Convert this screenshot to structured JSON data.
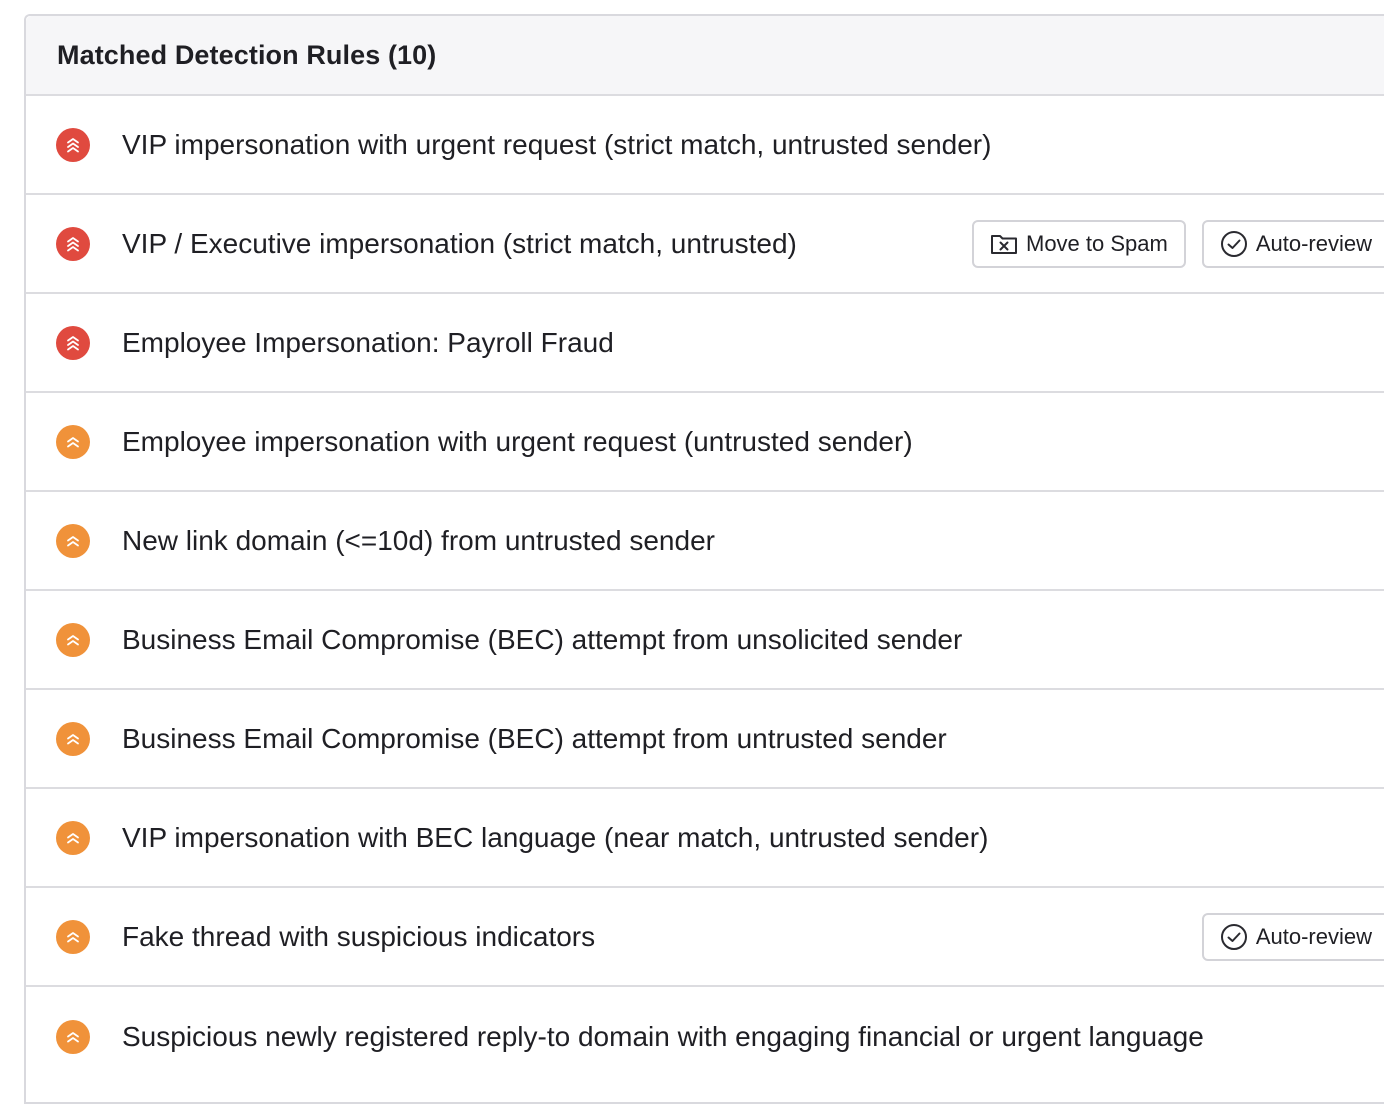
{
  "panel": {
    "title": "Matched Detection Rules (10)"
  },
  "colors": {
    "severity_high": "#e04a3f",
    "severity_medium": "#f0923a"
  },
  "actions": {
    "move_to_spam_label": "Move to Spam",
    "auto_review_label": "Auto-review",
    "move_to_spam_icon": "folder-x-icon",
    "auto_review_icon": "check-circle-icon"
  },
  "rules": [
    {
      "label": "VIP impersonation with urgent request (strict match, untrusted sender)",
      "severity": "high",
      "severity_icon": "triple-chevron-up-icon",
      "actions": []
    },
    {
      "label": "VIP / Executive impersonation (strict match, untrusted)",
      "severity": "high",
      "severity_icon": "triple-chevron-up-icon",
      "actions": [
        "move_to_spam",
        "auto_review"
      ]
    },
    {
      "label": "Employee Impersonation: Payroll Fraud",
      "severity": "high",
      "severity_icon": "triple-chevron-up-icon",
      "actions": []
    },
    {
      "label": "Employee impersonation with urgent request (untrusted sender)",
      "severity": "medium",
      "severity_icon": "double-chevron-up-icon",
      "actions": []
    },
    {
      "label": "New link domain (<=10d) from untrusted sender",
      "severity": "medium",
      "severity_icon": "double-chevron-up-icon",
      "actions": []
    },
    {
      "label": "Business Email Compromise (BEC) attempt from unsolicited sender",
      "severity": "medium",
      "severity_icon": "double-chevron-up-icon",
      "actions": []
    },
    {
      "label": "Business Email Compromise (BEC) attempt from untrusted sender",
      "severity": "medium",
      "severity_icon": "double-chevron-up-icon",
      "actions": []
    },
    {
      "label": "VIP impersonation with BEC language (near match, untrusted sender)",
      "severity": "medium",
      "severity_icon": "double-chevron-up-icon",
      "actions": []
    },
    {
      "label": "Fake thread with suspicious indicators",
      "severity": "medium",
      "severity_icon": "double-chevron-up-icon",
      "actions": [
        "auto_review"
      ]
    },
    {
      "label": "Suspicious newly registered reply-to domain with engaging financial or urgent language",
      "severity": "medium",
      "severity_icon": "double-chevron-up-icon",
      "actions": []
    }
  ]
}
